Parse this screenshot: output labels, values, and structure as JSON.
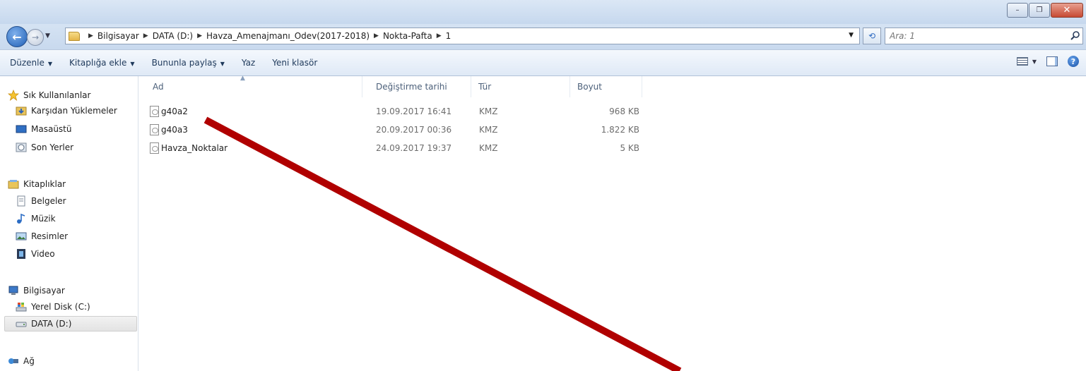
{
  "window": {
    "controls": {
      "minimize": "–",
      "maximize": "❐",
      "close": "✕"
    }
  },
  "address": {
    "crumbs": [
      "Bilgisayar",
      "DATA (D:)",
      "Havza_Amenajmanı_Odev(2017-2018)",
      "Nokta-Pafta",
      "1"
    ],
    "search_placeholder": "Ara: 1"
  },
  "toolbar": {
    "organize": "Düzenle",
    "add_to_library": "Kitaplığa ekle",
    "share_with": "Bununla paylaş",
    "burn": "Yaz",
    "new_folder": "Yeni klasör"
  },
  "nav": {
    "favorites": {
      "label": "Sık Kullanılanlar",
      "items": [
        "Karşıdan Yüklemeler",
        "Masaüstü",
        "Son Yerler"
      ]
    },
    "libraries": {
      "label": "Kitaplıklar",
      "items": [
        "Belgeler",
        "Müzik",
        "Resimler",
        "Video"
      ]
    },
    "computer": {
      "label": "Bilgisayar",
      "items": [
        "Yerel Disk (C:)",
        "DATA (D:)"
      ]
    },
    "network": {
      "label": "Ağ"
    }
  },
  "columns": {
    "name": "Ad",
    "date": "Değiştirme tarihi",
    "type": "Tür",
    "size": "Boyut"
  },
  "files": [
    {
      "name": "g40a2",
      "date": "19.09.2017 16:41",
      "type": "KMZ",
      "size": "968 KB"
    },
    {
      "name": "g40a3",
      "date": "20.09.2017 00:36",
      "type": "KMZ",
      "size": "1.822 KB"
    },
    {
      "name": "Havza_Noktalar",
      "date": "24.09.2017 19:37",
      "type": "KMZ",
      "size": "5 KB"
    }
  ],
  "annotation_color": "#b00000"
}
